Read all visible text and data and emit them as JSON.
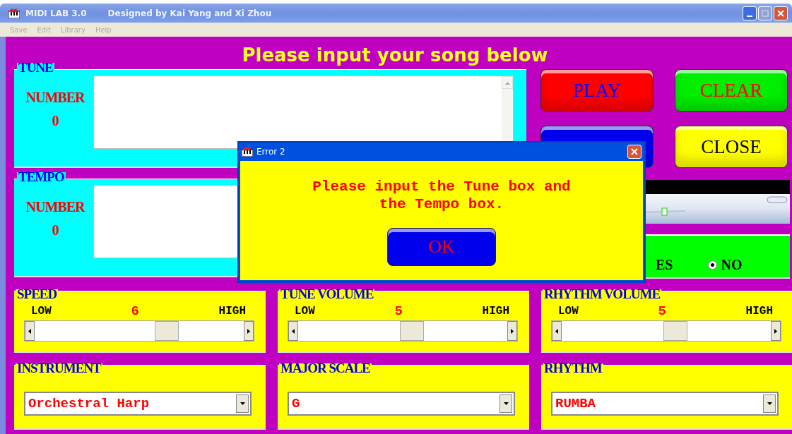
{
  "window": {
    "title": "MIDI LAB 3.0",
    "subtitle": "Designed by Kai Yang and Xi Zhou"
  },
  "menu": [
    {
      "label": "Save",
      "disabled": true
    },
    {
      "label": "Edit",
      "disabled": true
    },
    {
      "label": "Library",
      "disabled": true
    },
    {
      "label": "Help",
      "disabled": true
    }
  ],
  "heading": "Please input your song below",
  "inputs": [
    {
      "title": "TUNE",
      "count_label": "NUMBER",
      "count": "0"
    },
    {
      "title": "TEMPO",
      "count_label": "NUMBER",
      "count": "0"
    }
  ],
  "buttons": [
    {
      "label": "PLAY",
      "color": "#ff0000"
    },
    {
      "label": "CLEAR",
      "color": "#00ee00"
    },
    {
      "color": "#0000ee"
    },
    {
      "label": "CLOSE",
      "color": "#ffff00"
    }
  ],
  "repeat_option": {
    "partial_label": "ES",
    "options": [
      {
        "label": "NO",
        "selected": true
      }
    ]
  },
  "sliders": [
    {
      "title": "SPEED",
      "low": "LOW",
      "high": "HIGH",
      "value": "6"
    },
    {
      "title": "TUNE VOLUME",
      "low": "LOW",
      "high": "HIGH",
      "value": "5"
    },
    {
      "title": "RHYTHM VOLUME",
      "low": "LOW",
      "high": "HIGH",
      "value": "5"
    }
  ],
  "dropdowns": [
    {
      "title": "INSTRUMENT",
      "value": "Orchestral Harp"
    },
    {
      "title": "MAJOR SCALE",
      "value": "G"
    },
    {
      "title": "RHYTHM",
      "value": "RUMBA"
    }
  ],
  "dialog": {
    "title": "Error 2",
    "message": "Please input the Tune box and the Tempo box.",
    "button": "OK"
  }
}
